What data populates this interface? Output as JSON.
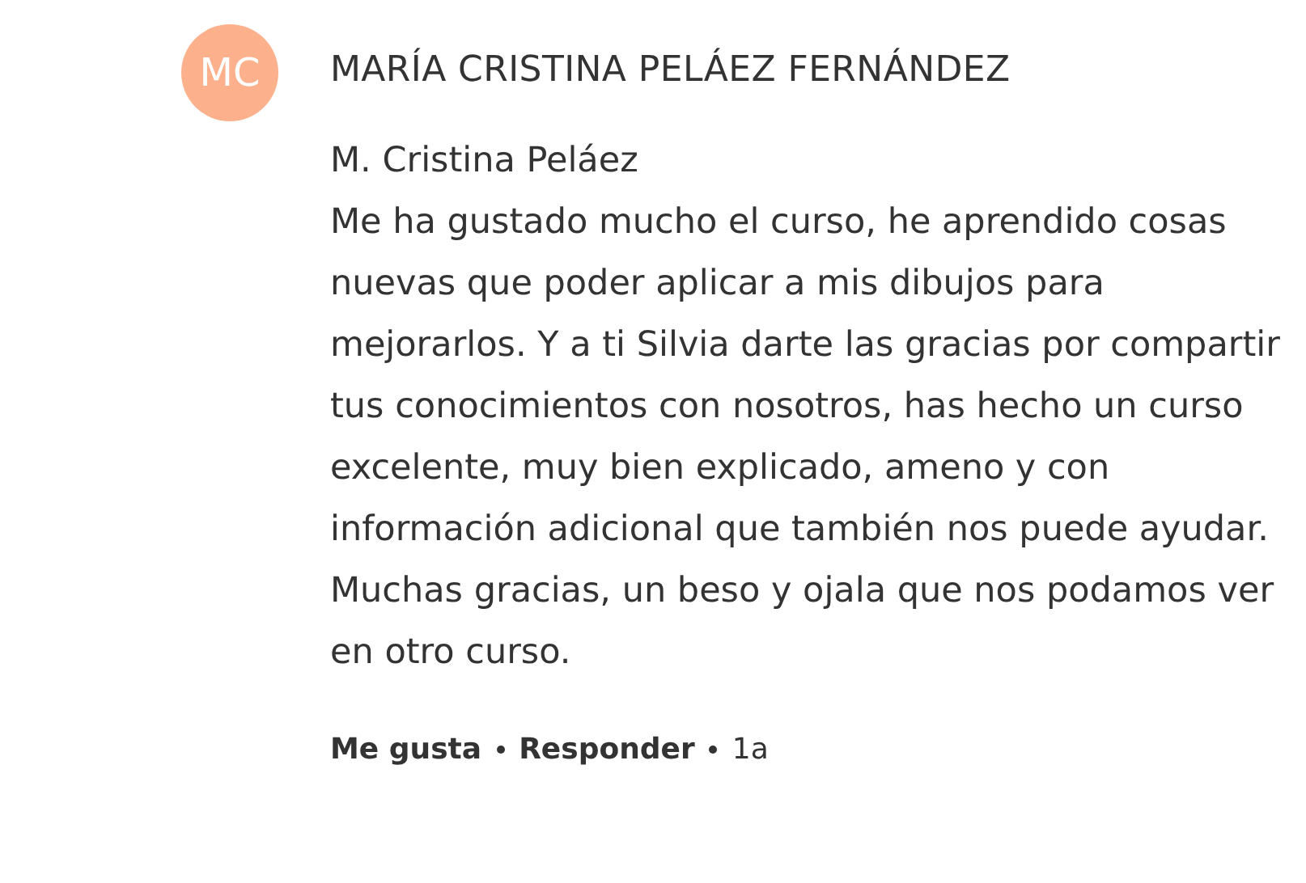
{
  "comment": {
    "avatar": {
      "initials": "MC",
      "color": "#fdb08c"
    },
    "author": "MARÍA CRISTINA PELÁEZ FERNÁNDEZ",
    "signature": "M. Cristina Peláez",
    "text": "Me ha gustado mucho el curso, he aprendido cosas nuevas que poder aplicar a mis dibujos para mejorarlos. Y a ti Silvia darte las gracias por compartir tus conocimientos con nosotros, has hecho un curso excelente, muy bien explicado, ameno y con información adicional que también nos puede ayudar. Muchas gracias, un beso y ojala que nos podamos ver en otro curso.",
    "actions": [
      {
        "kind": "link",
        "label": "Me gusta"
      },
      {
        "kind": "link",
        "label": "Responder"
      },
      {
        "kind": "time",
        "label": "1a"
      }
    ]
  }
}
